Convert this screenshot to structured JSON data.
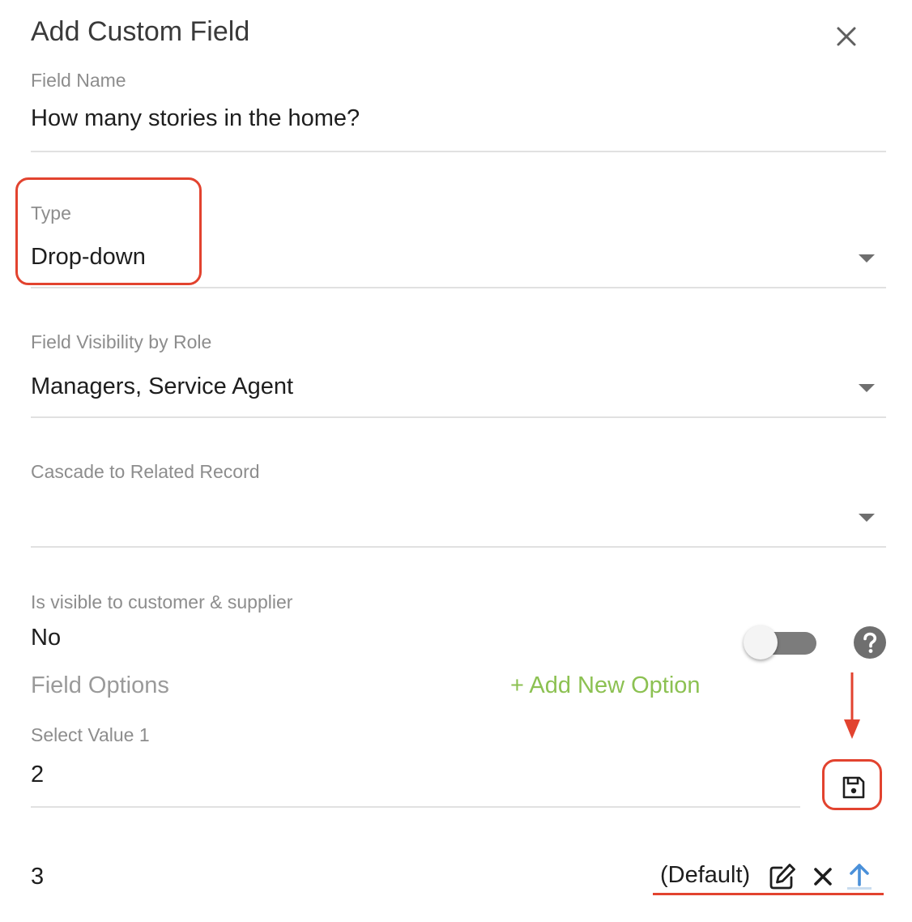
{
  "dialog": {
    "title": "Add Custom Field"
  },
  "field_name": {
    "label": "Field Name",
    "value": "How many stories in the home?"
  },
  "type": {
    "label": "Type",
    "value": "Drop-down"
  },
  "visibility": {
    "label": "Field Visibility by Role",
    "value": "Managers, Service Agent"
  },
  "cascade": {
    "label": "Cascade to Related Record",
    "value": ""
  },
  "customer_visible": {
    "label": "Is visible to customer & supplier",
    "value": "No",
    "toggle_on": false
  },
  "field_options": {
    "title": "Field Options",
    "add_label": "+ Add New Option",
    "select_label": "Select Value 1",
    "select_value": "2",
    "options": [
      {
        "value": "3",
        "badge": "(Default)"
      }
    ]
  },
  "colors": {
    "accent_green": "#8cc152",
    "highlight_red": "#e2432f",
    "link_blue": "#4a90d9"
  },
  "icons": [
    "close-icon",
    "chevron-down-icon",
    "help-icon",
    "save-icon",
    "edit-icon",
    "delete-icon",
    "arrow-up-icon"
  ]
}
